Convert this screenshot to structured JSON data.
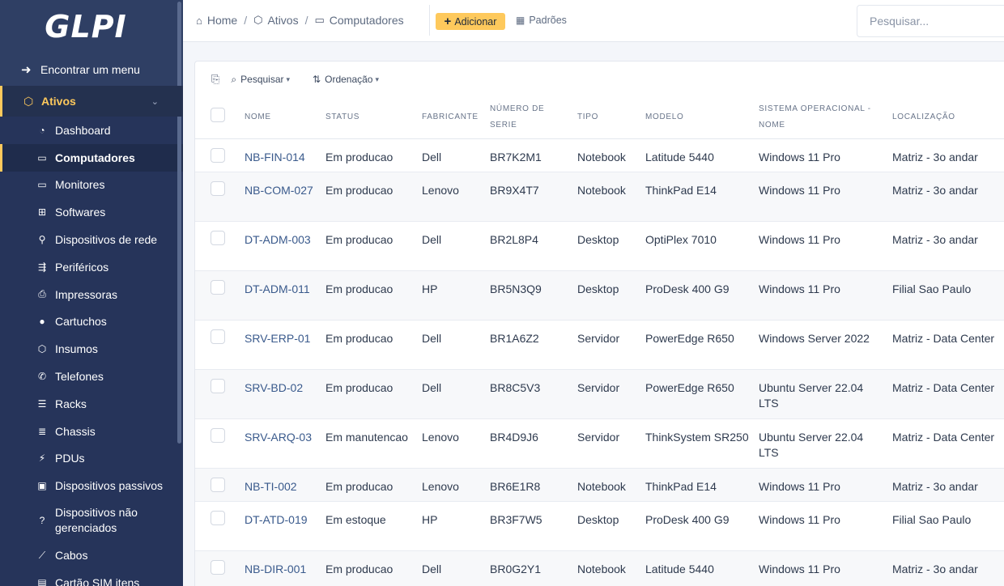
{
  "app": {
    "logo_text": "GLPI"
  },
  "sidebar": {
    "find_menu_label": "Encontrar um menu",
    "section_label": "Ativos",
    "items": [
      {
        "label": "Dashboard",
        "icon": "gauge-icon",
        "glyph": "◔"
      },
      {
        "label": "Computadores",
        "icon": "laptop-icon",
        "glyph": "▭",
        "active": true
      },
      {
        "label": "Monitores",
        "icon": "monitor-icon",
        "glyph": "▭"
      },
      {
        "label": "Softwares",
        "icon": "apps-icon",
        "glyph": "⊞"
      },
      {
        "label": "Dispositivos de rede",
        "icon": "network-icon",
        "glyph": "⚲"
      },
      {
        "label": "Periféricos",
        "icon": "usb-icon",
        "glyph": "⇶"
      },
      {
        "label": "Impressoras",
        "icon": "printer-icon",
        "glyph": "⎙"
      },
      {
        "label": "Cartuchos",
        "icon": "droplet-icon",
        "glyph": "●"
      },
      {
        "label": "Insumos",
        "icon": "box-icon",
        "glyph": "⬡"
      },
      {
        "label": "Telefones",
        "icon": "phone-icon",
        "glyph": "✆"
      },
      {
        "label": "Racks",
        "icon": "server-icon",
        "glyph": "☰"
      },
      {
        "label": "Chassis",
        "icon": "columns-icon",
        "glyph": "≣"
      },
      {
        "label": "PDUs",
        "icon": "plug-icon",
        "glyph": "⚡"
      },
      {
        "label": "Dispositivos passivos",
        "icon": "device-icon",
        "glyph": "▣"
      },
      {
        "label": "Dispositivos não gerenciados",
        "icon": "question-icon",
        "glyph": "?"
      },
      {
        "label": "Cabos",
        "icon": "cable-icon",
        "glyph": "⟋"
      },
      {
        "label": "Cartão SIM itens",
        "icon": "sim-card-icon",
        "glyph": "▤"
      }
    ]
  },
  "breadcrumb": {
    "home": "Home",
    "assets": "Ativos",
    "computers": "Computadores"
  },
  "header": {
    "add_label": "Adicionar",
    "defaults_label": "Padrões",
    "search_placeholder": "Pesquisar..."
  },
  "toolbar": {
    "search_label": "Pesquisar",
    "sort_label": "Ordenação"
  },
  "table": {
    "columns": [
      "NOME",
      "STATUS",
      "FABRICANTE",
      "NÚMERO DE SERIE",
      "TIPO",
      "MODELO",
      "SISTEMA OPERACIONAL - NOME",
      "LOCALIZAÇÃO"
    ],
    "rows": [
      [
        "NB-FIN-014",
        "Em producao",
        "Dell",
        "BR7K2M1",
        "Notebook",
        "Latitude 5440",
        "Windows 11 Pro",
        "Matriz - 3o andar"
      ],
      [
        "NB-COM-027",
        "Em producao",
        "Lenovo",
        "BR9X4T7",
        "Notebook",
        "ThinkPad E14",
        "Windows 11 Pro",
        "Matriz - 3o andar"
      ],
      [
        "DT-ADM-003",
        "Em producao",
        "Dell",
        "BR2L8P4",
        "Desktop",
        "OptiPlex 7010",
        "Windows 11 Pro",
        "Matriz - 3o andar"
      ],
      [
        "DT-ADM-011",
        "Em producao",
        "HP",
        "BR5N3Q9",
        "Desktop",
        "ProDesk 400 G9",
        "Windows 11 Pro",
        "Filial Sao Paulo"
      ],
      [
        "SRV-ERP-01",
        "Em producao",
        "Dell",
        "BR1A6Z2",
        "Servidor",
        "PowerEdge R650",
        "Windows Server 2022",
        "Matriz - Data Center"
      ],
      [
        "SRV-BD-02",
        "Em producao",
        "Dell",
        "BR8C5V3",
        "Servidor",
        "PowerEdge R650",
        "Ubuntu Server 22.04 LTS",
        "Matriz - Data Center"
      ],
      [
        "SRV-ARQ-03",
        "Em manutencao",
        "Lenovo",
        "BR4D9J6",
        "Servidor",
        "ThinkSystem SR250",
        "Ubuntu Server 22.04 LTS",
        "Matriz - Data Center"
      ],
      [
        "NB-TI-002",
        "Em producao",
        "Lenovo",
        "BR6E1R8",
        "Notebook",
        "ThinkPad E14",
        "Windows 11 Pro",
        "Matriz - 3o andar"
      ],
      [
        "DT-ATD-019",
        "Em estoque",
        "HP",
        "BR3F7W5",
        "Desktop",
        "ProDesk 400 G9",
        "Windows 11 Pro",
        "Filial Sao Paulo"
      ],
      [
        "NB-DIR-001",
        "Em producao",
        "Dell",
        "BR0G2Y1",
        "Notebook",
        "Latitude 5440",
        "Windows 11 Pro",
        "Matriz - 3o andar"
      ]
    ]
  },
  "colors": {
    "sidebar_bg": "#2f3f64",
    "accent": "#fec95c",
    "link": "#3a5a8c"
  }
}
